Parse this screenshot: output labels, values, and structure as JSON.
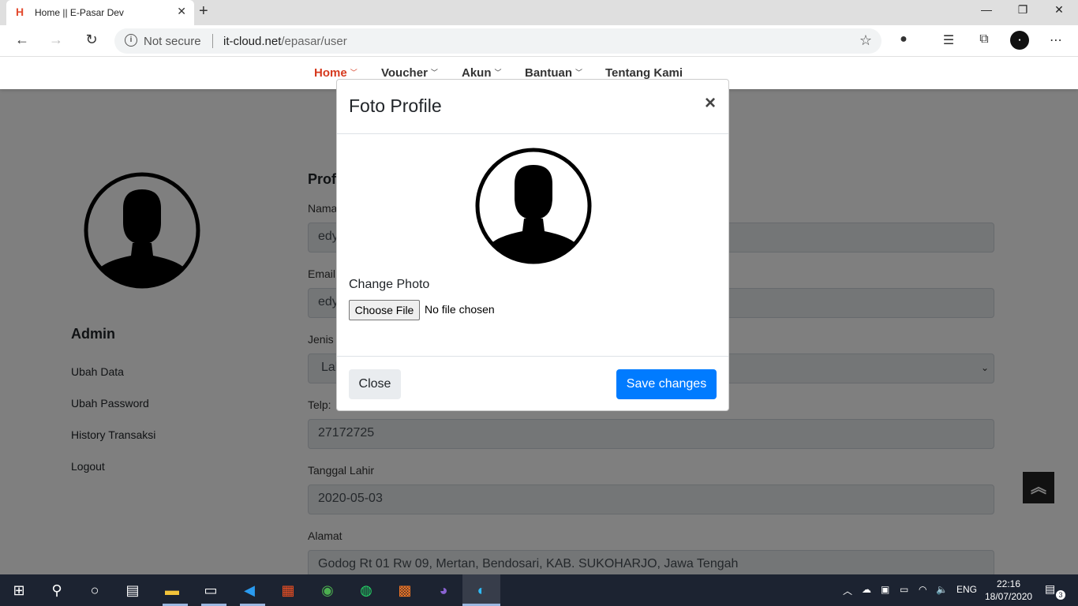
{
  "browser": {
    "tab_title": "Home || E-Pasar Dev",
    "new_tab": "+",
    "url_security": "Not secure",
    "url_host": "it-cloud.net",
    "url_path": "/epasar/user"
  },
  "site_nav": {
    "items": [
      {
        "label": "Home",
        "active": true
      },
      {
        "label": "Voucher"
      },
      {
        "label": "Akun"
      },
      {
        "label": "Bantuan"
      },
      {
        "label": "Tentang Kami"
      }
    ]
  },
  "sidebar": {
    "title": "Admin",
    "links": [
      "Ubah Data",
      "Ubah Password",
      "History Transaksi",
      "Logout"
    ]
  },
  "form": {
    "heading": "Profi",
    "fields": [
      {
        "label": "Nama",
        "value": "edy"
      },
      {
        "label": "Email",
        "value": "edy"
      },
      {
        "label": "Jenis K",
        "value": "Lal"
      },
      {
        "label": "Telp:",
        "value": "27172725"
      },
      {
        "label": "Tanggal Lahir",
        "value": "2020-05-03"
      },
      {
        "label": "Alamat",
        "value": "Godog Rt 01 Rw 09, Mertan, Bendosari, KAB. SUKOHARJO, Jawa Tengah"
      }
    ]
  },
  "modal": {
    "title": "Foto Profile",
    "close_symbol": "×",
    "change_label": "Change Photo",
    "file_button": "Choose File",
    "file_status": "No file chosen",
    "close_button": "Close",
    "save_button": "Save changes"
  },
  "taskbar": {
    "language": "ENG",
    "time": "22:16",
    "date": "18/07/2020",
    "notifications": "3"
  },
  "colors": {
    "nav_active": "#d63a1f",
    "primary_button": "#007bff",
    "taskbar": "#1c2331"
  }
}
